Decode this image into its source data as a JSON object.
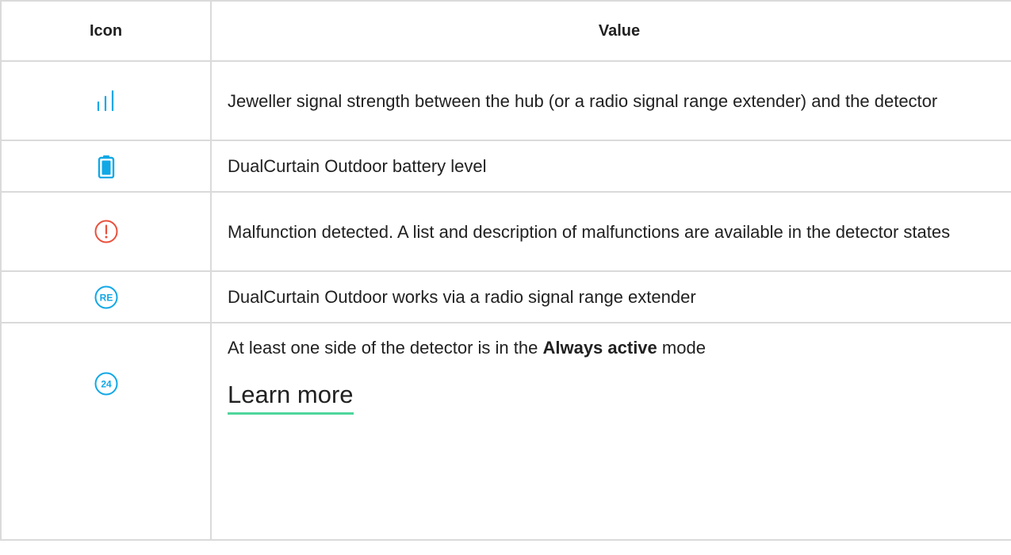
{
  "table": {
    "headers": {
      "icon": "Icon",
      "value": "Value"
    },
    "rows": [
      {
        "icon": "signal-strength-icon",
        "icon_color": "#11a8e6",
        "text": "Jeweller signal strength between the hub (or a radio signal range extender) and the detector"
      },
      {
        "icon": "battery-icon",
        "icon_color": "#11a8e6",
        "text": "DualCurtain Outdoor battery level"
      },
      {
        "icon": "malfunction-icon",
        "icon_color": "#e9503d",
        "text": "Malfunction detected. A list and description of malfunctions are available in the detector states"
      },
      {
        "icon": "range-extender-icon",
        "icon_color": "#11a8e6",
        "icon_text": "RE",
        "text": "DualCurtain Outdoor works via a radio signal range extender"
      },
      {
        "icon": "always-active-icon",
        "icon_color": "#11a8e6",
        "icon_text": "24",
        "text_before": "At least one side of the detector is in the ",
        "text_bold": "Always active",
        "text_after": " mode",
        "link_label": "Learn more",
        "link_underline_color": "#4fd69c"
      }
    ]
  }
}
